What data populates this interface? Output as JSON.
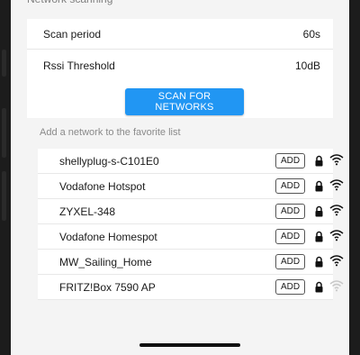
{
  "header": {
    "title": "Network scanning"
  },
  "settings": {
    "scan_period_label": "Scan period",
    "scan_period_value": "60s",
    "rssi_label": "Rssi Threshold",
    "rssi_value": "10dB",
    "scan_button": "SCAN FOR NETWORKS"
  },
  "favorites": {
    "section_label": "Add a network to the favorite list",
    "add_label": "ADD",
    "networks": [
      {
        "name": "shellyplug-s-C101E0",
        "signal": "strong"
      },
      {
        "name": "Vodafone Hotspot",
        "signal": "strong"
      },
      {
        "name": "ZYXEL-348",
        "signal": "strong"
      },
      {
        "name": "Vodafone Homespot",
        "signal": "strong"
      },
      {
        "name": "MW_Sailing_Home",
        "signal": "strong"
      },
      {
        "name": "FRITZ!Box 7590 AP",
        "signal": "weak"
      }
    ]
  },
  "colors": {
    "accent": "#2196f3",
    "background": "#f4f4f4"
  },
  "icons": {
    "lock": "lock-icon",
    "wifi": "wifi-icon"
  }
}
